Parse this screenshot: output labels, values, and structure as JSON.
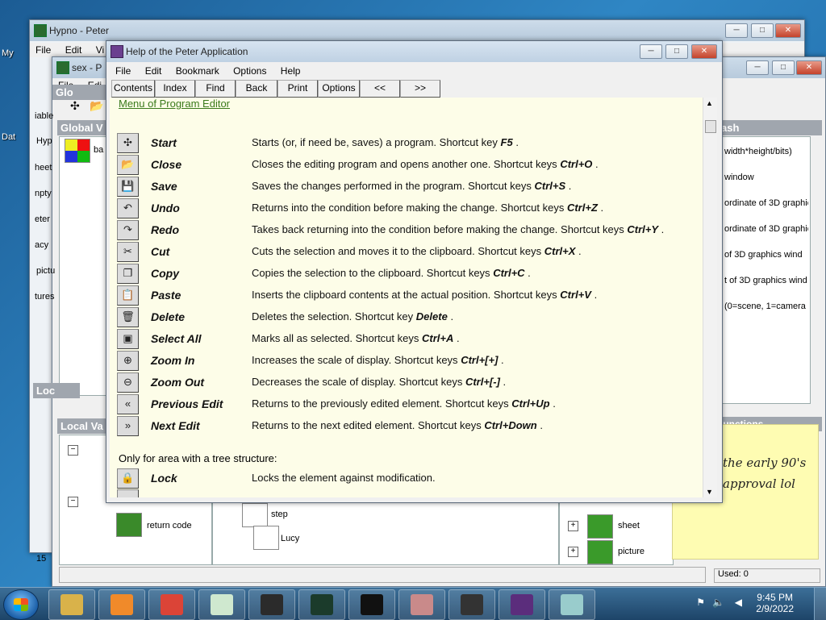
{
  "desktop": {
    "labels": [
      "My",
      "Dat"
    ]
  },
  "bg_window_hypno": {
    "title": "Hypno - Peter",
    "menu": [
      "File",
      "Edit",
      "Vi"
    ]
  },
  "bg_window_sex": {
    "title": "sex - P",
    "menu": [
      "File",
      "Edi"
    ],
    "global_head": "Glo",
    "global_vars_head": "Global V",
    "local_head": "Loc",
    "local_vars_head": "Local Va",
    "left_items": [
      "iable",
      "Hyp",
      "heet",
      "npty",
      "eter",
      "acy",
      "pictu",
      "tures"
    ],
    "tree_top_label": "ba",
    "right_panel_head": "rash",
    "right_items": [
      "width*height/bits)",
      "window",
      "ordinate of 3D graphic",
      "ordinate of 3D graphic",
      "of 3D graphics wind",
      "t of 3D graphics wind",
      "(0=scene, 1=camera"
    ],
    "functions_head": "Functions",
    "return_code": "return code",
    "tree_step": "step",
    "tree_lucy": "Lucy",
    "tree_sheet": "sheet",
    "tree_picture": "picture",
    "status_used": "Used: 0",
    "bottom_label": "15"
  },
  "sticky_note": {
    "line1": "the early 90's",
    "line2": "approval lol"
  },
  "help_window": {
    "title": "Help of the Peter Application",
    "menu": [
      "File",
      "Edit",
      "Bookmark",
      "Options",
      "Help"
    ],
    "toolbar": [
      "Contents",
      "Index",
      "Find",
      "Back",
      "Print",
      "Options",
      "<<",
      ">>"
    ],
    "link": "Menu of Program Editor",
    "rows": [
      {
        "icon": "start-icon",
        "glyph": "✣",
        "name": "Start",
        "desc": "Starts (or, if need be, saves) a program. Shortcut key",
        "key": "F5"
      },
      {
        "icon": "open-folder-icon",
        "glyph": "📂",
        "name": "Close",
        "desc": "Closes the editing program and opens another one. Shortcut keys",
        "key": "Ctrl+O"
      },
      {
        "icon": "save-icon",
        "glyph": "💾",
        "name": "Save",
        "desc": "Saves the changes performed in the program. Shortcut keys",
        "key": "Ctrl+S"
      },
      {
        "icon": "undo-icon",
        "glyph": "↶",
        "name": "Undo",
        "desc": "Returns into the condition before making the change. Shortcut keys",
        "key": "Ctrl+Z"
      },
      {
        "icon": "redo-icon",
        "glyph": "↷",
        "name": "Redo",
        "desc": "Takes back returning into the condition before making the change. Shortcut keys",
        "key": "Ctrl+Y"
      },
      {
        "icon": "scissors-icon",
        "glyph": "✂",
        "name": "Cut",
        "desc": "Cuts the selection and moves it to the clipboard. Shortcut keys",
        "key": "Ctrl+X"
      },
      {
        "icon": "copy-icon",
        "glyph": "❐",
        "name": "Copy",
        "desc": "Copies the selection to the clipboard. Shortcut keys",
        "key": "Ctrl+C"
      },
      {
        "icon": "paste-icon",
        "glyph": "📋",
        "name": "Paste",
        "desc": "Inserts the clipboard contents at the actual position. Shortcut keys",
        "key": "Ctrl+V"
      },
      {
        "icon": "trash-icon",
        "glyph": "🗑",
        "name": "Delete",
        "desc": "Deletes the selection. Shortcut key",
        "key": "Delete"
      },
      {
        "icon": "select-all-icon",
        "glyph": "▣",
        "name": "Select All",
        "desc": "Marks all as selected. Shortcut keys",
        "key": "Ctrl+A"
      },
      {
        "icon": "zoom-in-icon",
        "glyph": "⊕",
        "name": "Zoom In",
        "desc": "Increases the scale of display. Shortcut keys",
        "key": "Ctrl+[+]"
      },
      {
        "icon": "zoom-out-icon",
        "glyph": "⊖",
        "name": "Zoom Out",
        "desc": "Decreases the scale of display. Shortcut keys",
        "key": "Ctrl+[-]"
      },
      {
        "icon": "previous-edit-icon",
        "glyph": "«",
        "name": "Previous Edit",
        "desc": "Returns to the previously edited element. Shortcut keys",
        "key": "Ctrl+Up"
      },
      {
        "icon": "next-edit-icon",
        "glyph": "»",
        "name": "Next Edit",
        "desc": "Returns to the next edited element. Shortcut keys",
        "key": "Ctrl+Down"
      }
    ],
    "subheading": "Only for area with a tree structure:",
    "lock_row": {
      "icon": "lock-icon",
      "glyph": "🔒",
      "name": "Lock",
      "desc": "Locks the element against modification."
    }
  },
  "taskbar": {
    "apps": [
      "explorer-icon",
      "media-player-icon",
      "chrome-icon",
      "peter-rabbit-icon",
      "cross-app-icon",
      "oscilloscope-icon",
      "cmd-icon",
      "grid-app-icon",
      "film-icon",
      "help-book-icon",
      "sticky-notes-icon"
    ],
    "time": "9:45 PM",
    "date": "2/9/2022"
  }
}
